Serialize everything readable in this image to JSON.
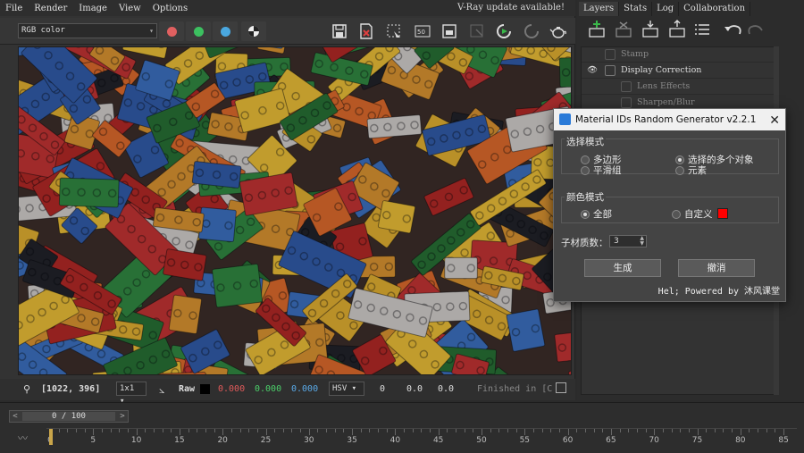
{
  "menubar": {
    "items": [
      "File",
      "Render",
      "Image",
      "View",
      "Options"
    ],
    "update_notice": "V-Ray update available!"
  },
  "toolbar": {
    "channel": "RGB color",
    "colors": {
      "red": "#e06060",
      "green": "#3cc060",
      "blue": "#4aa8e0"
    }
  },
  "statusbar": {
    "coords": "[1022, 396]",
    "zoom": "1x1",
    "mode": "Raw",
    "r": "0.000",
    "g": "0.000",
    "b": "0.000",
    "color_space": "HSV",
    "h": "0",
    "s": "0.0",
    "v": "0.0",
    "finished": "Finished in [C"
  },
  "right_panel": {
    "tabs": [
      "Layers",
      "Stats",
      "Log",
      "Collaboration"
    ],
    "layers": [
      "Stamp",
      "Display Correction",
      "Lens Effects",
      "Sharpen/Blur"
    ]
  },
  "dialog": {
    "title": "Material IDs Random Generator v2.2.1",
    "select_mode_title": "选择模式",
    "select_mode_options": [
      "多边形",
      "平滑组",
      "选择的多个对象",
      "元素"
    ],
    "color_mode_title": "颜色模式",
    "color_mode_options": [
      "全部",
      "自定义"
    ],
    "custom_color": "#ff0000",
    "submat_label": "子材质数：",
    "submat_value": "3",
    "generate": "生成",
    "cancel": "撤消",
    "footer": "Hel; Powered by 沐风课堂"
  },
  "timeline": {
    "frame": "0 / 100",
    "labels": [
      "0",
      "5",
      "10",
      "15",
      "20",
      "25",
      "30",
      "35",
      "40",
      "45",
      "50",
      "55",
      "60",
      "65",
      "70",
      "75",
      "80",
      "85"
    ]
  }
}
